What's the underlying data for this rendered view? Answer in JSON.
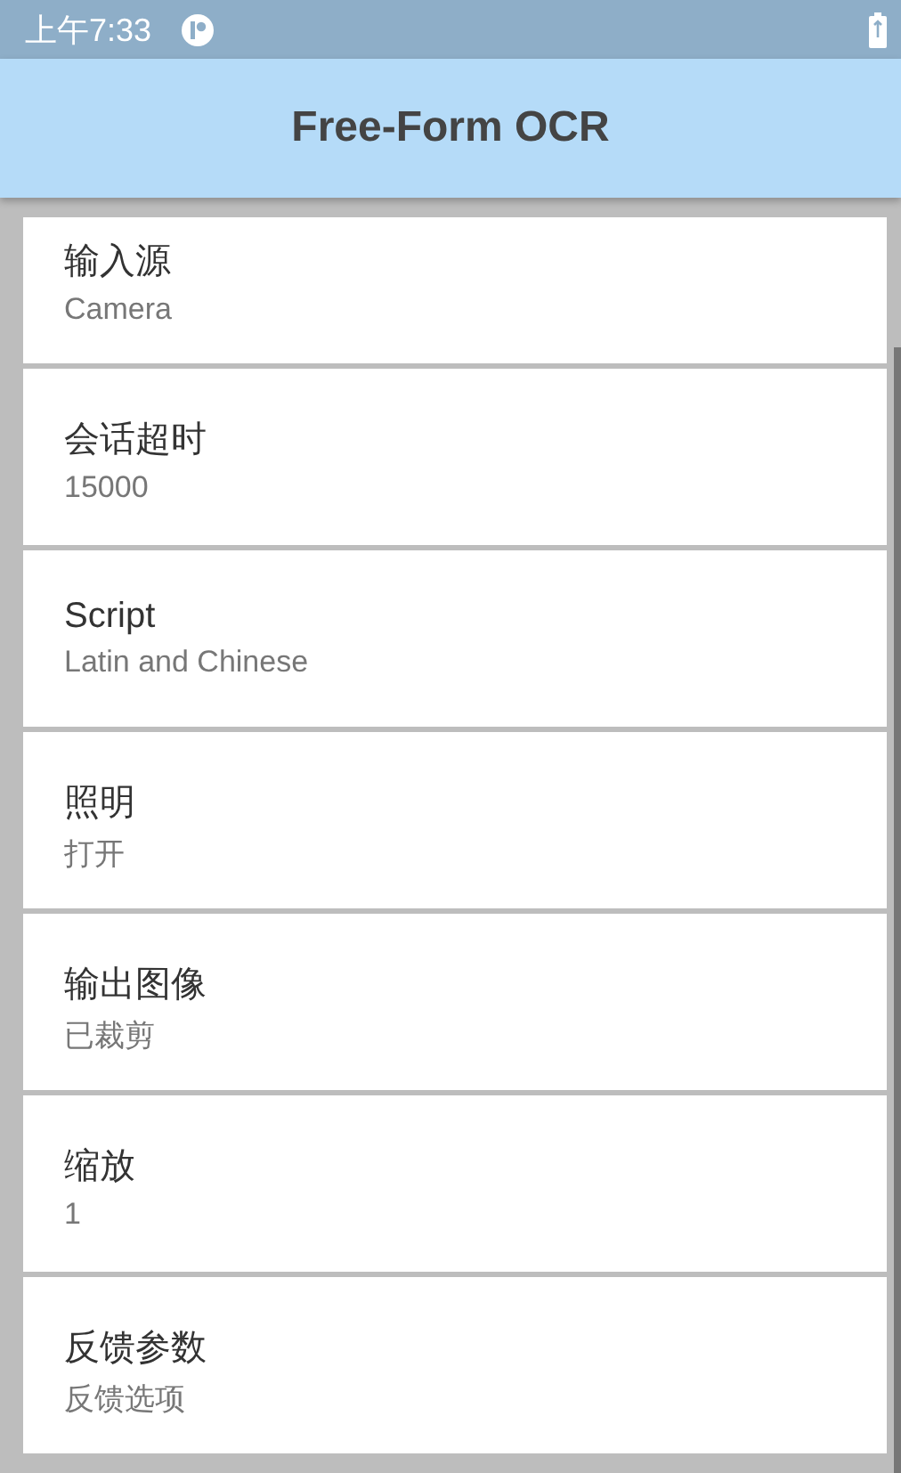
{
  "status_bar": {
    "time": "上午7:33"
  },
  "app_bar": {
    "title": "Free-Form OCR"
  },
  "settings": [
    {
      "title": "输入源",
      "value": "Camera"
    },
    {
      "title": "会话超时",
      "value": "15000"
    },
    {
      "title": "Script",
      "value": "Latin and Chinese"
    },
    {
      "title": "照明",
      "value": "打开"
    },
    {
      "title": "输出图像",
      "value": "已裁剪"
    },
    {
      "title": "缩放",
      "value": "1"
    },
    {
      "title": "反馈参数",
      "value": "反馈选项"
    }
  ]
}
